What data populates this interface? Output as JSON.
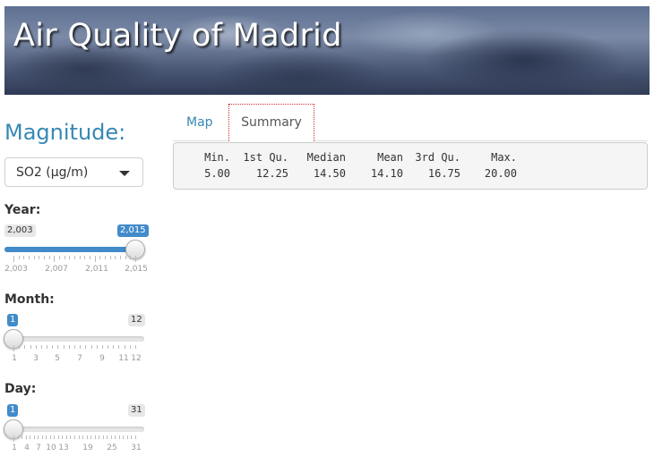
{
  "header": {
    "title": "Air Quality of Madrid"
  },
  "sidebar": {
    "magnitude": {
      "label": "Magnitude:",
      "selected": "SO2 (µg/m)"
    },
    "year": {
      "label": "Year:",
      "min_label": "2,003",
      "value_label": "2,015",
      "value_fraction": 1.0,
      "tick_labels": [
        "2,003",
        "2,007",
        "2,011",
        "2,015"
      ]
    },
    "month": {
      "label": "Month:",
      "value_label": "1",
      "max_label": "12",
      "value_fraction": 0.0,
      "tick_labels": [
        "1",
        "3",
        "5",
        "7",
        "9",
        "11",
        "12"
      ]
    },
    "day": {
      "label": "Day:",
      "value_label": "1",
      "max_label": "31",
      "value_fraction": 0.0,
      "tick_labels": [
        "1",
        "4",
        "7",
        "10",
        "13",
        "19",
        "25",
        "31"
      ]
    }
  },
  "tabs": [
    {
      "label": "Map",
      "active": false
    },
    {
      "label": "Summary",
      "active": true
    }
  ],
  "summary": {
    "headers": [
      "Min.",
      "1st Qu.",
      "Median",
      "Mean",
      "3rd Qu.",
      "Max."
    ],
    "values": [
      "5.00",
      "12.25",
      "14.50",
      "14.10",
      "16.75",
      "20.00"
    ]
  },
  "colors": {
    "accent": "#3788b5",
    "slider_fill": "#428bca",
    "output_bg": "#f5f5f5"
  }
}
